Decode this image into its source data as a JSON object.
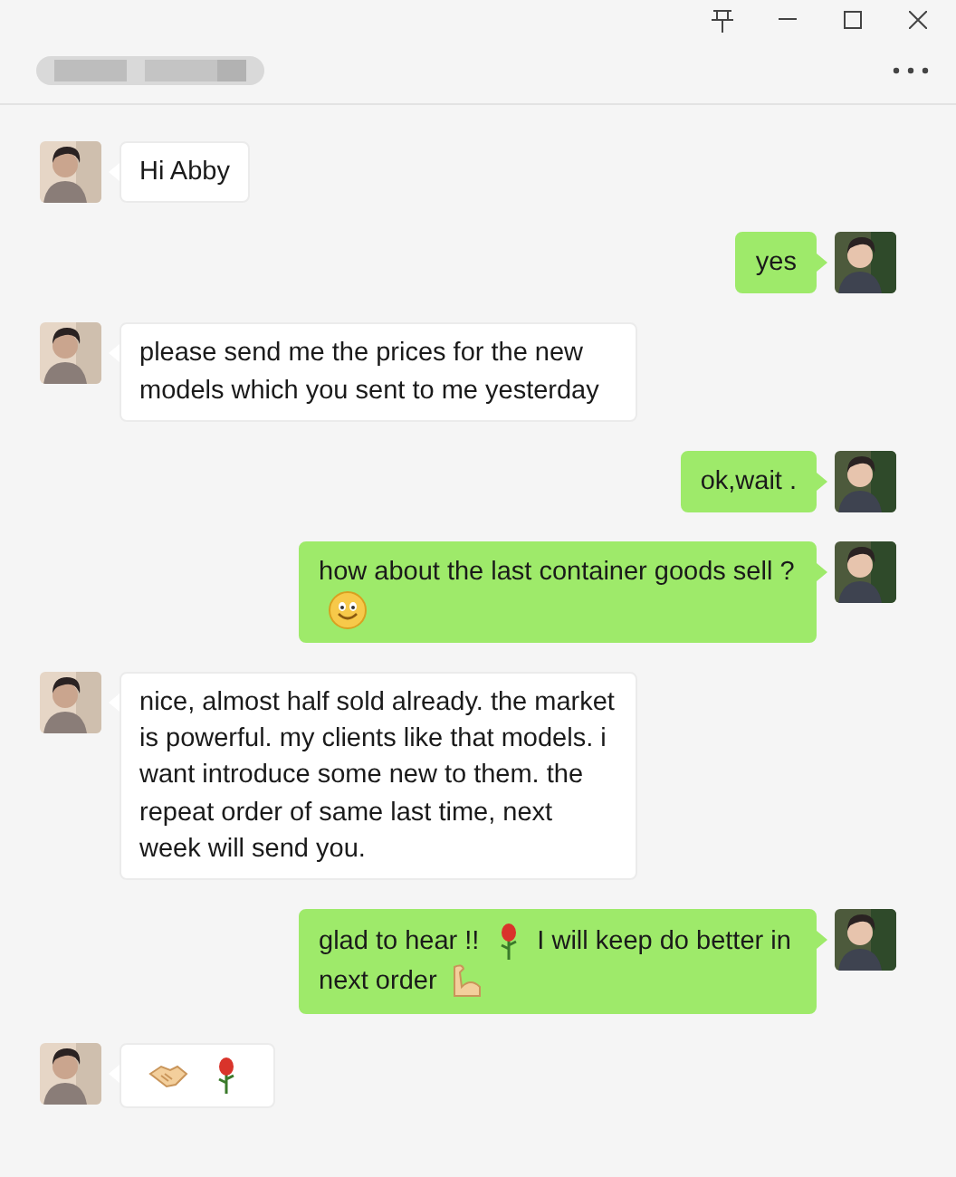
{
  "messages": [
    {
      "outgoing": false,
      "parts": [
        {
          "kind": "text",
          "text": "Hi Abby"
        }
      ]
    },
    {
      "outgoing": true,
      "parts": [
        {
          "kind": "text",
          "text": "yes"
        }
      ]
    },
    {
      "outgoing": false,
      "parts": [
        {
          "kind": "text",
          "text": "please send me the prices for the new models which you sent to me yesterday"
        }
      ]
    },
    {
      "outgoing": true,
      "parts": [
        {
          "kind": "text",
          "text": "ok,wait ."
        }
      ]
    },
    {
      "outgoing": true,
      "parts": [
        {
          "kind": "text",
          "text": "how about the last container goods sell ?"
        },
        {
          "kind": "smile"
        }
      ]
    },
    {
      "outgoing": false,
      "parts": [
        {
          "kind": "text",
          "text": "nice, almost half sold already.  the market is powerful.  my clients like that models.  i want introduce some new to them. the repeat order of same last time, next week will send you."
        }
      ]
    },
    {
      "outgoing": true,
      "parts": [
        {
          "kind": "text",
          "text": "glad to hear !!"
        },
        {
          "kind": "rose"
        },
        {
          "kind": "text",
          "text": "I will keep do better in next order"
        },
        {
          "kind": "muscle"
        }
      ]
    },
    {
      "outgoing": false,
      "parts": [
        {
          "kind": "handshake"
        },
        {
          "kind": "rose"
        }
      ]
    }
  ]
}
